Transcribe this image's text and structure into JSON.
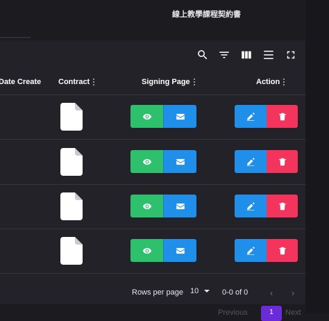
{
  "page": {
    "title": "線上教學課程契約書"
  },
  "toolbar": {
    "icons": [
      "search-icon",
      "filter-icon",
      "columns-icon",
      "density-icon",
      "fullscreen-icon"
    ]
  },
  "table": {
    "columns": [
      {
        "label": "Date Create"
      },
      {
        "label": "Contract"
      },
      {
        "label": "Signing Page"
      },
      {
        "label": "Action"
      }
    ],
    "rows": [
      {
        "contract": "file-icon",
        "signing": [
          "view-icon",
          "mail-icon"
        ],
        "action": [
          "edit-icon",
          "delete-icon"
        ]
      },
      {
        "contract": "file-icon",
        "signing": [
          "view-icon",
          "mail-icon"
        ],
        "action": [
          "edit-icon",
          "delete-icon"
        ]
      },
      {
        "contract": "file-icon",
        "signing": [
          "view-icon",
          "mail-icon"
        ],
        "action": [
          "edit-icon",
          "delete-icon"
        ]
      },
      {
        "contract": "file-icon",
        "signing": [
          "view-icon",
          "mail-icon"
        ],
        "action": [
          "edit-icon",
          "delete-icon"
        ]
      }
    ]
  },
  "footer": {
    "rows_per_page_label": "Rows per page",
    "rows_per_page_value": "10",
    "range": "0-0 of 0",
    "prev_icon": "‹",
    "next_icon": "›"
  },
  "pagination": {
    "previous": "Previous",
    "current_page": "1",
    "next": "Next"
  },
  "colors": {
    "view": "#2fc06d",
    "mail": "#1f8fea",
    "edit": "#1f8fea",
    "delete": "#f3355e",
    "active_page": "#6a2bd8"
  }
}
